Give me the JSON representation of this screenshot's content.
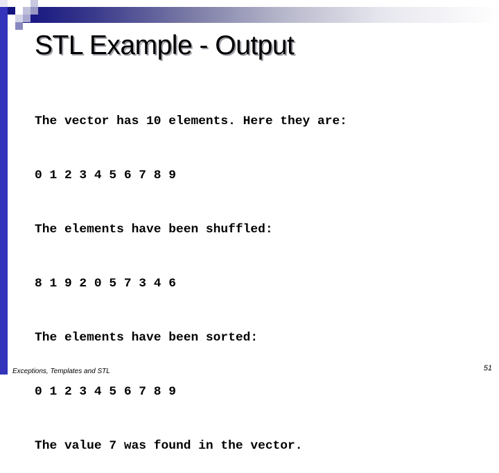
{
  "slide": {
    "title": "STL Example - Output",
    "output_lines": [
      "The vector has 10 elements. Here they are:",
      "0 1 2 3 4 5 6 7 8 9",
      "The elements have been shuffled:",
      "8 1 9 2 0 5 7 3 4 6",
      "The elements have been sorted:",
      "0 1 2 3 4 5 6 7 8 9",
      "The value 7 was found in the vector."
    ],
    "footer_text": "Exceptions, Templates and STL",
    "page_number": "51"
  },
  "colors": {
    "accent_blue": "#3333bb",
    "dark_navy": "#141480",
    "title_shadow": "#a0a0a8"
  }
}
